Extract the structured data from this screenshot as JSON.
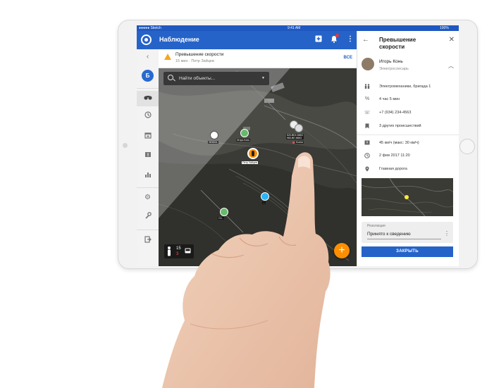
{
  "status_bar": {
    "carrier": "●●●●● Sketch",
    "time": "9:41 AM",
    "battery": "100%"
  },
  "app_bar": {
    "title": "Наблюдение"
  },
  "notification": {
    "title": "Превышение скорости",
    "subtitle": "15 мин · Петр Зайцев",
    "all_label": "ВСЕ"
  },
  "sidebar": {
    "avatar_letter": "Б"
  },
  "search": {
    "placeholder": "Найти объекты..."
  },
  "map_markers": [
    {
      "label": "ЭЕ8001",
      "kind": "truck"
    },
    {
      "label": "Игорь Конь",
      "kind": "person"
    },
    {
      "label": "520-ВЕ4 ММО\n983-ВЕ ММО",
      "kind": "vehicle-cluster"
    },
    {
      "label": "Kuntor",
      "kind": "place"
    },
    {
      "label": "Петр Зайцев",
      "kind": "person-alert"
    },
    {
      "label": "С3...",
      "kind": "vehicle"
    },
    {
      "label": "...",
      "kind": "vehicle"
    },
    {
      "label": "420-540 ММО",
      "kind": "vehicle"
    }
  ],
  "counter": {
    "people_total": "15",
    "people_alert": "3"
  },
  "panel": {
    "title": "Превышение скорости",
    "user_name": "Игорь Конь",
    "user_role": "Электрослесарь",
    "team": "Электромеханики, бригада 1",
    "duration": "4 час 5 мин",
    "phone": "+7 (934) 234-4563",
    "other_incidents": "3 других происшествий",
    "speed": "45 км/ч (макс: 30 км/ч)",
    "datetime": "2 фев 2017 11:20",
    "location": "Главная дорога",
    "resolution_label": "Резолюция",
    "resolution_value": "Принято к сведению",
    "close_label": "ЗАКРЫТЬ"
  },
  "colors": {
    "primary": "#2563c9",
    "accent": "#ff8f00",
    "warning": "#f5a623",
    "marker_green": "#66bb6a",
    "marker_blue": "#29b6f6"
  }
}
